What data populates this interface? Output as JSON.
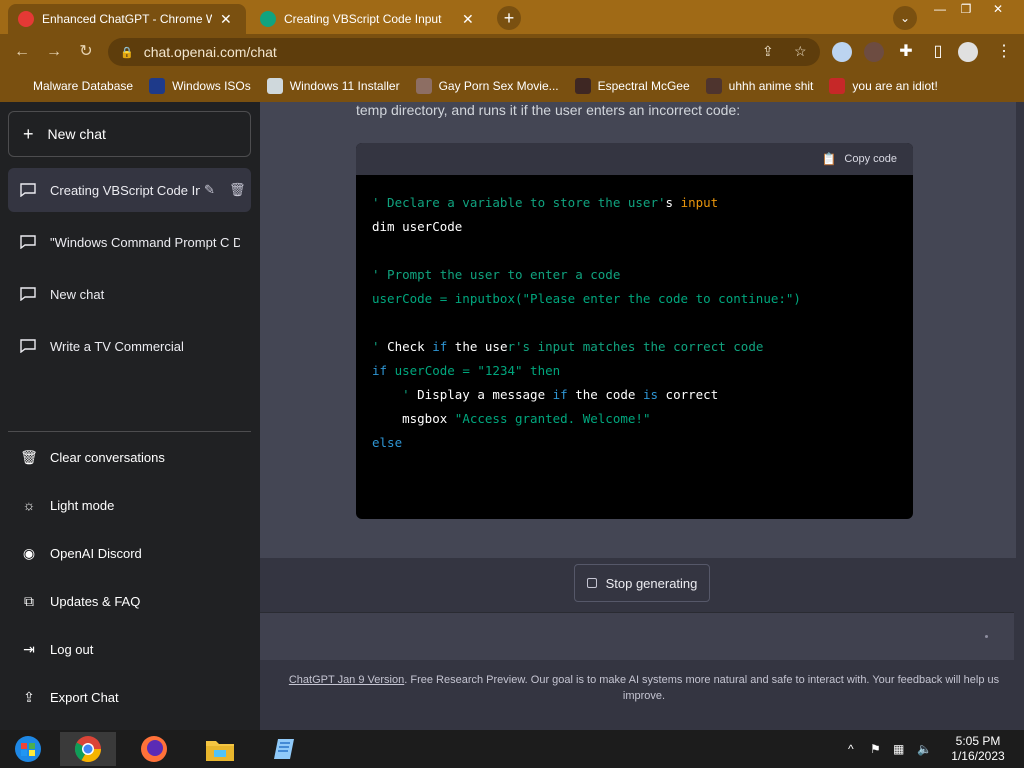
{
  "browser": {
    "tabs": [
      {
        "title": "Enhanced ChatGPT - Chrome Web",
        "close": "✕",
        "active": true
      },
      {
        "title": "Creating VBScript Code Input",
        "close": "✕",
        "active": false
      }
    ],
    "new_tab": "+",
    "tab_search": "⌄",
    "window_controls": [
      "—",
      "❐",
      "✕"
    ],
    "url": "chat.openai.com/chat",
    "bookmarks": [
      {
        "label": "Malware Database",
        "icon": "malware-icon",
        "color": "#7a5010"
      },
      {
        "label": "Windows ISOs",
        "icon": "x-icon",
        "color": "#1e3a8a"
      },
      {
        "label": "Windows 11 Installer",
        "icon": "image-icon",
        "color": "#cfd8dc"
      },
      {
        "label": "Gay Porn Sex Movie...",
        "icon": "figure-icon",
        "color": "#8d6e63"
      },
      {
        "label": "Espectral McGee",
        "icon": "character-icon",
        "color": "#3e2723"
      },
      {
        "label": "uhhh anime shit",
        "icon": "anime-icon",
        "color": "#4e342e"
      },
      {
        "label": "you are an idiot!",
        "icon": "flag-icon",
        "color": "#c62828"
      }
    ]
  },
  "sidebar": {
    "new_chat": "New chat",
    "conversations": [
      {
        "label": "Creating VBScript Code In",
        "active": true
      },
      {
        "label": "\"Windows Command Prompt C D",
        "active": false
      },
      {
        "label": "New chat",
        "active": false
      },
      {
        "label": "Write a TV Commercial",
        "active": false
      }
    ],
    "menu": [
      {
        "label": "Clear conversations",
        "icon": "trash-icon"
      },
      {
        "label": "Light mode",
        "icon": "sun-icon"
      },
      {
        "label": "OpenAI Discord",
        "icon": "discord-icon"
      },
      {
        "label": "Updates & FAQ",
        "icon": "external-link-icon"
      },
      {
        "label": "Log out",
        "icon": "logout-icon"
      },
      {
        "label": "Export Chat",
        "icon": "export-icon"
      }
    ]
  },
  "main": {
    "intro_text": "temp directory, and runs it if the user enters an incorrect code:",
    "copy_code": "Copy code",
    "stop_generating": "Stop generating",
    "disclaimer_link": "ChatGPT Jan 9 Version",
    "disclaimer_text": ". Free Research Preview. Our goal is to make AI systems more natural and safe to interact with. Your feedback will help us improve."
  },
  "taskbar": {
    "time": "5:05 PM",
    "date": "1/16/2023",
    "apps": [
      "start-icon",
      "chrome-icon",
      "firefox-icon",
      "file-explorer-icon",
      "notepad-icon"
    ]
  }
}
